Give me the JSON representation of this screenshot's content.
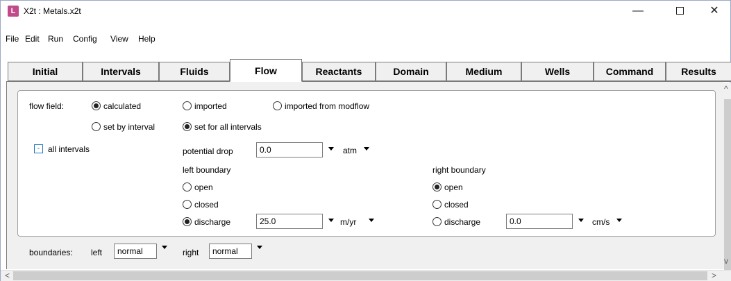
{
  "window": {
    "title": "X2t : Metals.x2t",
    "app_icon": "x2t-app-icon",
    "controls": {
      "minimize": "—",
      "close": "✕"
    }
  },
  "menu": [
    "File",
    "Edit",
    "Run",
    "Config",
    "View",
    "Help"
  ],
  "tabs": [
    "Initial",
    "Intervals",
    "Fluids",
    "Flow",
    "Reactants",
    "Domain",
    "Medium",
    "Wells",
    "Command",
    "Results"
  ],
  "active_tab": "Flow",
  "flow_field": {
    "label": "flow field:",
    "options": {
      "calculated": "calculated",
      "imported": "imported",
      "imported_modflow": "imported from modflow",
      "set_by_interval": "set by interval",
      "set_all": "set for all intervals"
    },
    "selected_source": "calculated",
    "selected_scope": "set for all intervals"
  },
  "intervals": {
    "toggle": "-",
    "label": "all intervals",
    "potential_drop": {
      "label": "potential drop",
      "value": "0.0",
      "unit": "atm"
    },
    "left_boundary": {
      "label": "left boundary",
      "open": "open",
      "closed": "closed",
      "discharge": "discharge",
      "selected": "discharge",
      "discharge_value": "25.0",
      "discharge_unit": "m/yr"
    },
    "right_boundary": {
      "label": "right boundary",
      "open": "open",
      "closed": "closed",
      "discharge": "discharge",
      "selected": "open",
      "discharge_value": "0.0",
      "discharge_unit": "cm/s"
    }
  },
  "boundaries": {
    "label": "boundaries:",
    "left_label": "left",
    "left_value": "normal",
    "right_label": "right",
    "right_value": "normal"
  },
  "scroll": {
    "left": "<",
    "right": ">",
    "up": "^",
    "down": "v"
  }
}
